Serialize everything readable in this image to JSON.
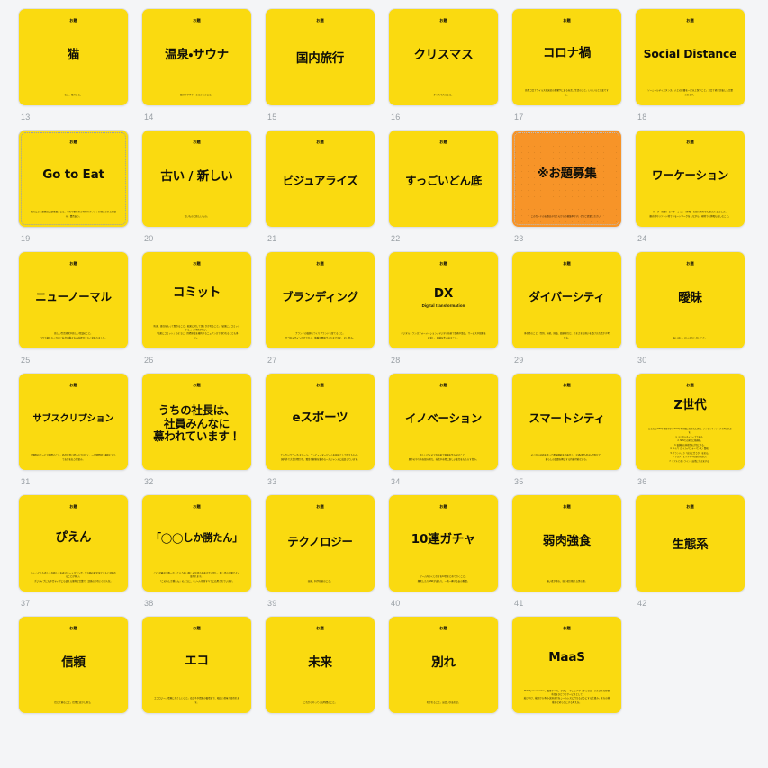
{
  "page": {
    "background_color": "#f4f5f7",
    "card_color": "#fada10",
    "accent_card_color": "#f79428",
    "index_color": "#9aa0a6",
    "columns": 6
  },
  "eyebrow_label": "お題",
  "cards": [
    {
      "index": "13",
      "eyebrow": "お題",
      "headline": "猫",
      "subhead": "",
      "body": "ねこ。猫である。",
      "accent": false,
      "selected": false,
      "size": ""
    },
    {
      "index": "14",
      "eyebrow": "お題",
      "headline": "温泉・サウナ",
      "subhead": "",
      "body": "温泉やサウナ、ととのうのこと。",
      "accent": false,
      "selected": false,
      "size": ""
    },
    {
      "index": "15",
      "eyebrow": "お題",
      "headline": "国内旅行",
      "subhead": "",
      "body": "",
      "accent": false,
      "selected": false,
      "size": ""
    },
    {
      "index": "16",
      "eyebrow": "お題",
      "headline": "クリスマス",
      "subhead": "",
      "body": "クリスマスのこと。",
      "accent": false,
      "selected": false,
      "size": ""
    },
    {
      "index": "17",
      "eyebrow": "お題",
      "headline": "コロナ禍",
      "subhead": "",
      "body": "新型コロナウイルス感染症の影響下にある社会、生活のこと。いろいろと大変ですね。",
      "accent": false,
      "selected": false,
      "size": ""
    },
    {
      "index": "18",
      "eyebrow": "お題",
      "headline": "Social Distance",
      "subhead": "",
      "body": "ソーシャルディスタンス。人との距離を一定以上保つこと。コロナ禍で定着した言葉のひとつ。",
      "accent": false,
      "selected": false,
      "size": "sz-m"
    },
    {
      "index": "19",
      "eyebrow": "お題",
      "headline": "Go to Eat",
      "subhead": "",
      "body": "政府による飲食店支援事業のこと。予約や食事券の利用でポイントが還元される仕組み。賛否あり。",
      "accent": false,
      "selected": true,
      "size": ""
    },
    {
      "index": "20",
      "eyebrow": "お題",
      "headline": "古い / 新しい",
      "subhead": "",
      "body": "古いものと新しいもの。",
      "accent": false,
      "selected": false,
      "size": ""
    },
    {
      "index": "21",
      "eyebrow": "お題",
      "headline": "ビジュアライズ",
      "subhead": "",
      "body": "",
      "accent": false,
      "selected": false,
      "size": "sz-m"
    },
    {
      "index": "22",
      "eyebrow": "お題",
      "headline": "すっごいどん底",
      "subhead": "",
      "body": "",
      "accent": false,
      "selected": false,
      "size": "sz-m"
    },
    {
      "index": "23",
      "eyebrow": "",
      "headline": "※お題募集",
      "subhead": "",
      "body": "このカードのお題はみなさんからの募集中です。ぜひご提案ください。",
      "accent": true,
      "selected": false,
      "size": ""
    },
    {
      "index": "24",
      "eyebrow": "お題",
      "headline": "ワーケーション",
      "subhead": "",
      "body": "ワーク（仕事）とバケーション（休暇）を組み合わせた働き方・過ごし方。\n観光地やリゾート地でリモートワークをしながら、現地での休暇も楽しむこと。",
      "accent": false,
      "selected": false,
      "size": "sz-m"
    },
    {
      "index": "25",
      "eyebrow": "お題",
      "headline": "ニューノーマル",
      "subhead": "",
      "body": "新しい生活様式や新しい常識のこと。\nコロナ禍をきっかけに社会や働き方の前提が大きく変わりました。",
      "accent": false,
      "selected": false,
      "size": "sz-m"
    },
    {
      "index": "26",
      "eyebrow": "お題",
      "headline": "コミット",
      "subhead": "",
      "body": "約束、責任をもって関わること。結果に対して深くかかわること。「結果に、コミットする。」の印象が強い。\n「結果にコミット」のように、目標達成を確約するニュアンスで使われることも多い。",
      "accent": false,
      "selected": false,
      "size": ""
    },
    {
      "index": "27",
      "eyebrow": "お題",
      "headline": "ブランディング",
      "subhead": "",
      "body": "ブランドの価値をつくりブランドを育てること。\nロゴやデザインだけでなく、体験や関係づくりまで含む、広い営み。",
      "accent": false,
      "selected": false,
      "size": "sz-m"
    },
    {
      "index": "28",
      "eyebrow": "お題",
      "headline": "DX",
      "subhead": "Digital transformation",
      "body": "デジタルトランスフォーメーション。デジタル技術で業務や製品、サービスや組織を変革し、価値を生み出すこと。",
      "accent": false,
      "selected": false,
      "size": ""
    },
    {
      "index": "29",
      "eyebrow": "お題",
      "headline": "ダイバーシティ",
      "subhead": "",
      "body": "多様性のこと。性別、年齢、国籍、価値観など、さまざまな違いを受け入れ活かす考え方。",
      "accent": false,
      "selected": false,
      "size": "sz-m"
    },
    {
      "index": "30",
      "eyebrow": "お題",
      "headline": "曖昧",
      "subhead": "",
      "body": "あいまい。はっきりしないこと。",
      "accent": false,
      "selected": false,
      "size": ""
    },
    {
      "index": "31",
      "eyebrow": "お題",
      "headline": "サブスクリプション",
      "subhead": "",
      "body": "定額制のサービス利用のこと。商品を買い切るのではなく、一定期間使う権利に対してお金を払う仕組み。",
      "accent": false,
      "selected": false,
      "size": "sz-xs"
    },
    {
      "index": "32",
      "eyebrow": "お題",
      "headline": "うちの社長は、\n社員みんなに\n慕われています！",
      "subhead": "",
      "body": "",
      "accent": false,
      "selected": false,
      "size": "sz-m"
    },
    {
      "index": "33",
      "eyebrow": "お題",
      "headline": "eスポーツ",
      "subhead": "",
      "body": "エレクトロニック・スポーツ。コンピューターゲームを競技として捉えたもの。\n国内外で大会が開かれ、賞金や観客を集める一大ジャンルに成長しています。",
      "accent": false,
      "selected": false,
      "size": ""
    },
    {
      "index": "34",
      "eyebrow": "お題",
      "headline": "イノベーション",
      "subhead": "",
      "body": "新しいアイデアや技術で価値を生み出すこと。\n既存のやり方を組み替え、社会や市場に新しい変化をもたらす営み。",
      "accent": false,
      "selected": false,
      "size": "sz-m"
    },
    {
      "index": "35",
      "eyebrow": "お題",
      "headline": "スマートシティ",
      "subhead": "",
      "body": "デジタル技術を使って都市機能を効率化し、交通・電力・防災・行政など、\n暮らしの課題を解決する持続可能なまち。",
      "accent": false,
      "selected": false,
      "size": "sz-m"
    },
    {
      "index": "36",
      "eyebrow": "お題",
      "headline": "Z世代",
      "subhead": "",
      "body": "おおむね1990年代後半から2010年代序盤に生まれた世代。デジタルネイティブと呼ばれます。\n1. デジタルネイティブである。\n2. SNSでの発信に積極的。\n3. 価値観の多様性を大切にする。\n4. タイパ（タイム・パフォーマンス）重視。\n5. ブランドより「自分に合うか」を見る。\n6. サステナビリティへの関心が高い。\n7. リアルとオンラインを自然に行き来する。",
      "accent": false,
      "selected": false,
      "size": ""
    },
    {
      "index": "37",
      "eyebrow": "お題",
      "headline": "ぴえん",
      "subhead": "",
      "body": "ちょっとした悲しさや嬉しさを表すネットスラング。泣き顔の絵文字とともに使われることが多い。\nポジティブにもネガティブにも使える便利な言葉で、語感のかわいさが人気。",
      "accent": false,
      "selected": false,
      "size": ""
    },
    {
      "index": "38",
      "eyebrow": "お題",
      "headline": "「◯◯しか勝たん」",
      "subhead": "",
      "body": "◯◯が最高で唯一だ、という強い推しの気持ちを表す言い回し。推し活の文脈でよく使われます。\n「この味しか勝たん」のように、モノ・人・場所すべてに応用されています。",
      "accent": false,
      "selected": false,
      "size": "sz-s"
    },
    {
      "index": "39",
      "eyebrow": "お題",
      "headline": "テクノロジー",
      "subhead": "",
      "body": "技術、科学技術のこと。",
      "accent": false,
      "selected": false,
      "size": "sz-m"
    },
    {
      "index": "40",
      "eyebrow": "お題",
      "headline": "10連ガチャ",
      "subhead": "",
      "body": "ゲーム内のくじ引きを10回まとめて引くこと。\n爆死したりSSRが出たり、一喜一憂するあの瞬間。",
      "accent": false,
      "selected": false,
      "size": ""
    },
    {
      "index": "41",
      "eyebrow": "お題",
      "headline": "弱肉強食",
      "subhead": "",
      "body": "強い者が勝ち、弱い者が敗れる世の理。",
      "accent": false,
      "selected": false,
      "size": ""
    },
    {
      "index": "42",
      "eyebrow": "お題",
      "headline": "生態系",
      "subhead": "",
      "body": "",
      "accent": false,
      "selected": false,
      "size": ""
    },
    {
      "index": "",
      "eyebrow": "お題",
      "headline": "信頼",
      "subhead": "",
      "body": "信じて頼ること。信用とは少し違う。",
      "accent": false,
      "selected": false,
      "size": ""
    },
    {
      "index": "",
      "eyebrow": "お題",
      "headline": "エコ",
      "subhead": "",
      "body": "エコロジー。環境にやさしいこと。省エネや資源の循環まで、幅広い意味で使われます。",
      "accent": false,
      "selected": false,
      "size": ""
    },
    {
      "index": "",
      "eyebrow": "お題",
      "headline": "未来",
      "subhead": "",
      "body": "これからやってくる時間のこと。",
      "accent": false,
      "selected": false,
      "size": ""
    },
    {
      "index": "",
      "eyebrow": "お題",
      "headline": "別れ",
      "subhead": "",
      "body": "わかれること。出会いがあれば。",
      "accent": false,
      "selected": false,
      "size": ""
    },
    {
      "index": "",
      "eyebrow": "お題",
      "headline": "MaaS",
      "subhead": "",
      "body": "Mobility as a Service。電車やバス、タクシーやシェアサイクルなど、さまざまな移動手段をひとつのサービスとして\n結びつけ、検索から予約・決済までをシームレスに行えるようにする仕組み。まちの移動をなめらかにする考え方。",
      "accent": false,
      "selected": false,
      "size": ""
    }
  ]
}
